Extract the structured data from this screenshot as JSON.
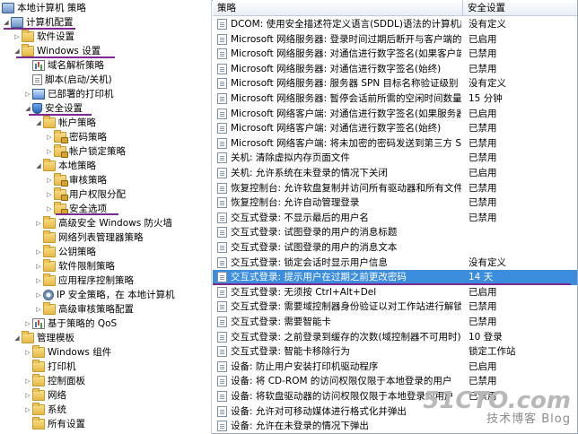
{
  "tree": {
    "nodes": [
      {
        "label": "本地计算机 策略",
        "icon": "pc-icon"
      },
      {
        "label": "计算机配置",
        "icon": "pc-icon"
      },
      {
        "label": "软件设置",
        "icon": "folder-icon"
      },
      {
        "label": "Windows 设置",
        "icon": "folder-icon"
      },
      {
        "label": "域名解析策略",
        "icon": "chart-icon"
      },
      {
        "label": "脚本(启动/关机)",
        "icon": "doc-icon"
      },
      {
        "label": "已部署的打印机",
        "icon": "printer-icon"
      },
      {
        "label": "安全设置",
        "icon": "shield-icon"
      },
      {
        "label": "帐户策略",
        "icon": "folder-icon"
      },
      {
        "label": "密码策略",
        "icon": "folder-lock-icon"
      },
      {
        "label": "帐户锁定策略",
        "icon": "folder-lock-icon"
      },
      {
        "label": "本地策略",
        "icon": "folder-icon"
      },
      {
        "label": "审核策略",
        "icon": "folder-lock-icon"
      },
      {
        "label": "用户权限分配",
        "icon": "folder-lock-icon"
      },
      {
        "label": "安全选项",
        "icon": "folder-lock-icon"
      },
      {
        "label": "高级安全 Windows 防火墙",
        "icon": "folder-icon"
      },
      {
        "label": "网络列表管理器策略",
        "icon": "folder-icon"
      },
      {
        "label": "公钥策略",
        "icon": "folder-icon"
      },
      {
        "label": "软件限制策略",
        "icon": "folder-icon"
      },
      {
        "label": "应用程序控制策略",
        "icon": "folder-icon"
      },
      {
        "label": "IP 安全策略，在 本地计算机",
        "icon": "gear-icon"
      },
      {
        "label": "高级审核策略配置",
        "icon": "folder-icon"
      },
      {
        "label": "基于策略的 QoS",
        "icon": "chart-icon"
      },
      {
        "label": "管理模板",
        "icon": "folder-icon"
      },
      {
        "label": "Windows 组件",
        "icon": "folder-icon"
      },
      {
        "label": "打印机",
        "icon": "folder-icon"
      },
      {
        "label": "控制面板",
        "icon": "folder-icon"
      },
      {
        "label": "网络",
        "icon": "folder-icon"
      },
      {
        "label": "系统",
        "icon": "folder-icon"
      },
      {
        "label": "所有设置",
        "icon": "folder-icon"
      }
    ]
  },
  "list": {
    "headers": {
      "policy": "策略",
      "setting": "安全设置"
    },
    "rows": [
      {
        "policy": "DCOM: 使用安全描述符定义语言(SDDL)语法的计算机启动...",
        "setting": "没有定义"
      },
      {
        "policy": "Microsoft 网络服务器: 登录时间过期后断开与客户端的连接",
        "setting": "已启用"
      },
      {
        "policy": "Microsoft 网络服务器: 对通信进行数字签名(如果客户端允...",
        "setting": "已禁用"
      },
      {
        "policy": "Microsoft 网络服务器: 对通信进行数字签名(始终)",
        "setting": "已禁用"
      },
      {
        "policy": "Microsoft 网络服务器: 服务器 SPN 目标名称验证级别",
        "setting": "没有定义"
      },
      {
        "policy": "Microsoft 网络服务器: 暂停会话前所需的空闲时间数量",
        "setting": "15 分钟"
      },
      {
        "policy": "Microsoft 网络客户端: 对通信进行数字签名(如果服务器允...",
        "setting": "已启用"
      },
      {
        "policy": "Microsoft 网络客户端: 对通信进行数字签名(始终)",
        "setting": "已禁用"
      },
      {
        "policy": "Microsoft 网络客户端: 将未加密的密码发送到第三方 SMB...",
        "setting": "已禁用"
      },
      {
        "policy": "关机: 清除虚拟内存页面文件",
        "setting": "已禁用"
      },
      {
        "policy": "关机: 允许系统在未登录的情况下关闭",
        "setting": "已启用"
      },
      {
        "policy": "恢复控制台: 允许软盘复制并访问所有驱动器和所有文件夹",
        "setting": "已禁用"
      },
      {
        "policy": "恢复控制台: 允许自动管理登录",
        "setting": "已禁用"
      },
      {
        "policy": "交互式登录: 不显示最后的用户名",
        "setting": "已禁用"
      },
      {
        "policy": "交互式登录: 试图登录的用户的消息标题",
        "setting": ""
      },
      {
        "policy": "交互式登录: 试图登录的用户的消息文本",
        "setting": ""
      },
      {
        "policy": "交互式登录: 锁定会话时显示用户信息",
        "setting": "没有定义"
      },
      {
        "policy": "交互式登录: 提示用户在过期之前更改密码",
        "setting": "14 天",
        "selected": true
      },
      {
        "policy": "交互式登录: 无须按 Ctrl+Alt+Del",
        "setting": "已启用"
      },
      {
        "policy": "交互式登录: 需要域控制器身份验证以对工作站进行解锁",
        "setting": "已禁用"
      },
      {
        "policy": "交互式登录: 需要智能卡",
        "setting": "已禁用"
      },
      {
        "policy": "交互式登录: 之前登录到缓存的次数(域控制器不可用时)",
        "setting": "10 登录"
      },
      {
        "policy": "交互式登录: 智能卡移除行为",
        "setting": "锁定工作站"
      },
      {
        "policy": "设备: 防止用户安装打印机驱动程序",
        "setting": "已启用"
      },
      {
        "policy": "设备: 将 CD-ROM 的访问权限仅限于本地登录的用户",
        "setting": "已禁用"
      },
      {
        "policy": "设备: 将软盘驱动器的访问权限仅限于本地登录的用户",
        "setting": "已禁用"
      },
      {
        "policy": "设备: 允许对可移动媒体进行格式化并弹出",
        "setting": ""
      },
      {
        "policy": "设备: 允许在未登录的情况下弹出",
        "setting": ""
      }
    ]
  },
  "watermark": {
    "line1": "51CTO.com",
    "line2": "技术博客 Blog"
  },
  "colors": {
    "selection": "#3c8ddd",
    "annotation": "#7b2a8f"
  }
}
